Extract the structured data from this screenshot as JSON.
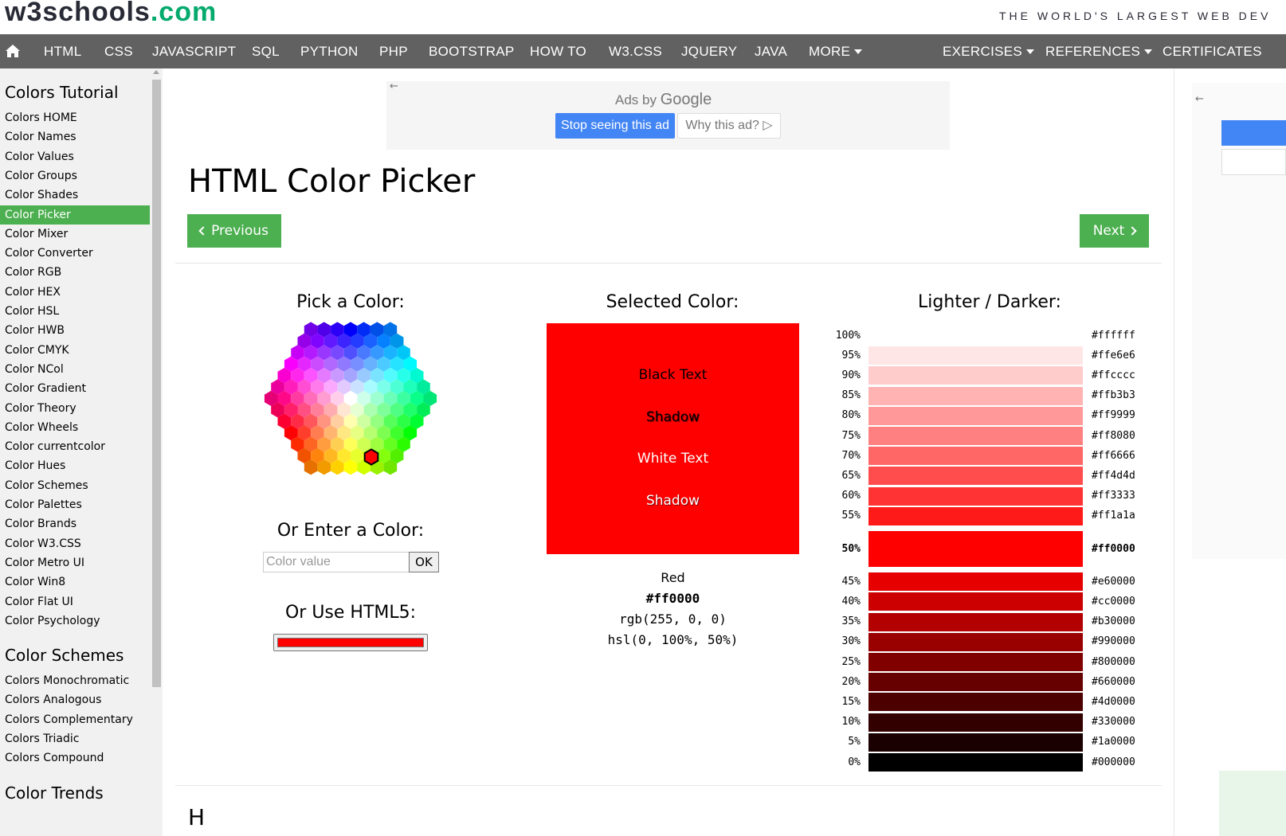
{
  "header": {
    "logo_main": "w3schools",
    "logo_dot": ".com",
    "tagline": "THE WORLD'S LARGEST WEB DEV"
  },
  "nav": {
    "home_icon": "home-icon",
    "left_items": [
      "HTML",
      "CSS",
      "JAVASCRIPT",
      "SQL",
      "PYTHON",
      "PHP",
      "BOOTSTRAP",
      "HOW TO",
      "W3.CSS",
      "JQUERY",
      "JAVA",
      "MORE"
    ],
    "right_items": [
      "EXERCISES",
      "REFERENCES",
      "CERTIFICATES"
    ]
  },
  "sidebar": {
    "heading1": "Colors Tutorial",
    "tutorial_links": [
      "Colors HOME",
      "Color Names",
      "Color Values",
      "Color Groups",
      "Color Shades",
      "Color Picker",
      "Color Mixer",
      "Color Converter",
      "Color RGB",
      "Color HEX",
      "Color HSL",
      "Color HWB",
      "Color CMYK",
      "Color NCol",
      "Color Gradient",
      "Color Theory",
      "Color Wheels",
      "Color currentcolor",
      "Color Hues",
      "Color Schemes",
      "Color Palettes",
      "Color Brands",
      "Color W3.CSS",
      "Color Metro UI",
      "Color Win8",
      "Color Flat UI",
      "Color Psychology"
    ],
    "active": "Color Picker",
    "heading2": "Color Schemes",
    "scheme_links": [
      "Colors Monochromatic",
      "Colors Analogous",
      "Colors Complementary",
      "Colors Triadic",
      "Colors Compound"
    ],
    "heading3": "Color Trends"
  },
  "ad": {
    "ads_by": "Ads by",
    "google": "Google",
    "stop": "Stop seeing this ad",
    "why": "Why this ad?"
  },
  "main": {
    "title": "HTML Color Picker",
    "prev": "Previous",
    "next": "Next",
    "pick_heading": "Pick a Color:",
    "enter_heading": "Or Enter a Color:",
    "input_placeholder": "Color value",
    "ok": "OK",
    "html5_heading": "Or Use HTML5:",
    "html5_value": "#ff0000",
    "selected_heading": "Selected Color:",
    "selected_color": "#ff0000",
    "sample_black": "Black Text",
    "sample_black_shadow": "Shadow",
    "sample_white": "White Text",
    "sample_white_shadow": "Shadow",
    "color_name": "Red",
    "color_hex": "#ff0000",
    "color_rgb": "rgb(255, 0, 0)",
    "color_hsl": "hsl(0, 100%, 50%)",
    "shades_heading": "Lighter / Darker:",
    "below_heading": "H"
  },
  "shades": [
    {
      "pct": "100%",
      "hex": "#ffffff"
    },
    {
      "pct": "95%",
      "hex": "#ffe6e6"
    },
    {
      "pct": "90%",
      "hex": "#ffcccc"
    },
    {
      "pct": "85%",
      "hex": "#ffb3b3"
    },
    {
      "pct": "80%",
      "hex": "#ff9999"
    },
    {
      "pct": "75%",
      "hex": "#ff8080"
    },
    {
      "pct": "70%",
      "hex": "#ff6666"
    },
    {
      "pct": "65%",
      "hex": "#ff4d4d"
    },
    {
      "pct": "60%",
      "hex": "#ff3333"
    },
    {
      "pct": "55%",
      "hex": "#ff1a1a"
    },
    {
      "pct": "50%",
      "hex": "#ff0000",
      "current": true
    },
    {
      "pct": "45%",
      "hex": "#e60000"
    },
    {
      "pct": "40%",
      "hex": "#cc0000"
    },
    {
      "pct": "35%",
      "hex": "#b30000"
    },
    {
      "pct": "30%",
      "hex": "#990000"
    },
    {
      "pct": "25%",
      "hex": "#800000"
    },
    {
      "pct": "20%",
      "hex": "#660000"
    },
    {
      "pct": "15%",
      "hex": "#4d0000"
    },
    {
      "pct": "10%",
      "hex": "#330000"
    },
    {
      "pct": "5%",
      "hex": "#1a0000"
    },
    {
      "pct": "0%",
      "hex": "#000000"
    }
  ],
  "colors": {
    "nav_bg": "#616161",
    "accent_green": "#4caf50",
    "sidebar_bg": "#f1f1f1",
    "google_blue": "#4285f4"
  }
}
